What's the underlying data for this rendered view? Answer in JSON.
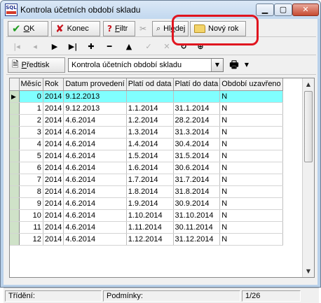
{
  "window": {
    "title": "Kontrola účetních období skladu",
    "minimize": "▁",
    "maximize": "▢",
    "close": "✕"
  },
  "toolbar": {
    "ok_label": "OK",
    "ok_underline": "O",
    "ok_rest": "K",
    "konec_label": "Konec",
    "filtr_u": "F",
    "filtr_rest": "iltr",
    "hledej_pre": "Hl",
    "hledej_u": "e",
    "hledej_rest": "dej",
    "novy_rok_label": "Nový rok"
  },
  "nav": {
    "first": "|◂",
    "prev": "◂",
    "next": "▶",
    "last": "▶|",
    "add": "✚",
    "remove": "━",
    "up": "▲",
    "confirm": "✓",
    "cancel": "✕",
    "refresh": "↻",
    "filter": "⊕"
  },
  "preview": {
    "button_u": "P",
    "button_rest": "ředtisk",
    "selected": "Kontrola účetních období skladu"
  },
  "grid": {
    "columns": [
      "Měsíc",
      "Rok",
      "Datum provedení",
      "Platí od data",
      "Platí do data",
      "Období uzavřeno"
    ],
    "rows": [
      [
        "0",
        "2014",
        "9.12.2013",
        "",
        "",
        "N"
      ],
      [
        "1",
        "2014",
        "9.12.2013",
        "1.1.2014",
        "31.1.2014",
        "N"
      ],
      [
        "2",
        "2014",
        "4.6.2014",
        "1.2.2014",
        "28.2.2014",
        "N"
      ],
      [
        "3",
        "2014",
        "4.6.2014",
        "1.3.2014",
        "31.3.2014",
        "N"
      ],
      [
        "4",
        "2014",
        "4.6.2014",
        "1.4.2014",
        "30.4.2014",
        "N"
      ],
      [
        "5",
        "2014",
        "4.6.2014",
        "1.5.2014",
        "31.5.2014",
        "N"
      ],
      [
        "6",
        "2014",
        "4.6.2014",
        "1.6.2014",
        "30.6.2014",
        "N"
      ],
      [
        "7",
        "2014",
        "4.6.2014",
        "1.7.2014",
        "31.7.2014",
        "N"
      ],
      [
        "8",
        "2014",
        "4.6.2014",
        "1.8.2014",
        "31.8.2014",
        "N"
      ],
      [
        "9",
        "2014",
        "4.6.2014",
        "1.9.2014",
        "30.9.2014",
        "N"
      ],
      [
        "10",
        "2014",
        "4.6.2014",
        "1.10.2014",
        "31.10.2014",
        "N"
      ],
      [
        "11",
        "2014",
        "4.6.2014",
        "1.11.2014",
        "30.11.2014",
        "N"
      ],
      [
        "12",
        "2014",
        "4.6.2014",
        "1.12.2014",
        "31.12.2014",
        "N"
      ]
    ],
    "selected_row": 0,
    "row_indicator": "▶"
  },
  "status": {
    "sort_label": "Třídění:",
    "conditions_label": "Podmínky:",
    "position": "1/26"
  },
  "colors": {
    "selection": "#80ffff",
    "highlight": "#e0151f",
    "indicator": "#cfe2c8"
  }
}
